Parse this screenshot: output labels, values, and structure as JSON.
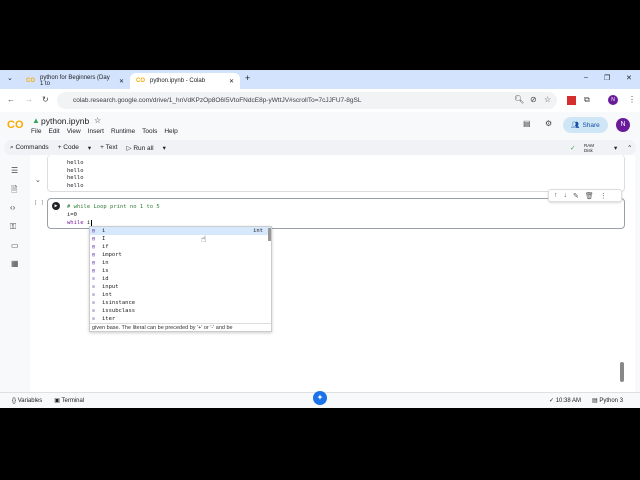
{
  "tabs": [
    {
      "label": "python for Beginners (Day 1 to",
      "active": false
    },
    {
      "label": "python.ipynb - Colab",
      "active": true
    }
  ],
  "url": "colab.research.google.com/drive/1_hnVdKPzOp8O6I5VtoFNdcE8p-yWttJV#scrollTo=7cJJFU7-8gSL",
  "notebook": {
    "title": "python.ipynb",
    "menu": [
      "File",
      "Edit",
      "View",
      "Insert",
      "Runtime",
      "Tools",
      "Help"
    ],
    "share": "Share",
    "avatar": "N"
  },
  "toolbar": {
    "commands": "Commands",
    "code": "+ Code",
    "text": "+ Text",
    "run_all": "Run all",
    "ram": "RAM",
    "disk": "Disk"
  },
  "output_lines": [
    "hello",
    "hello",
    "hello",
    "hello"
  ],
  "cell": {
    "bracket": "[ ]",
    "comment": "# while Loop print no 1 to 5",
    "line2": "i=0",
    "keyword": "while",
    "typed": "i"
  },
  "autocomplete": {
    "items": [
      {
        "label": "i",
        "type": "int"
      },
      {
        "label": "I"
      },
      {
        "label": "if"
      },
      {
        "label": "import"
      },
      {
        "label": "in"
      },
      {
        "label": "is"
      },
      {
        "label": "id"
      },
      {
        "label": "input"
      },
      {
        "label": "int"
      },
      {
        "label": "isinstance"
      },
      {
        "label": "issubclass"
      },
      {
        "label": "iter"
      }
    ],
    "doc": "given base.  The literal can be preceded by '+' or '-' and be"
  },
  "statusbar": {
    "variables": "Variables",
    "terminal": "Terminal",
    "time": "10:38 AM",
    "kernel": "Python 3"
  }
}
